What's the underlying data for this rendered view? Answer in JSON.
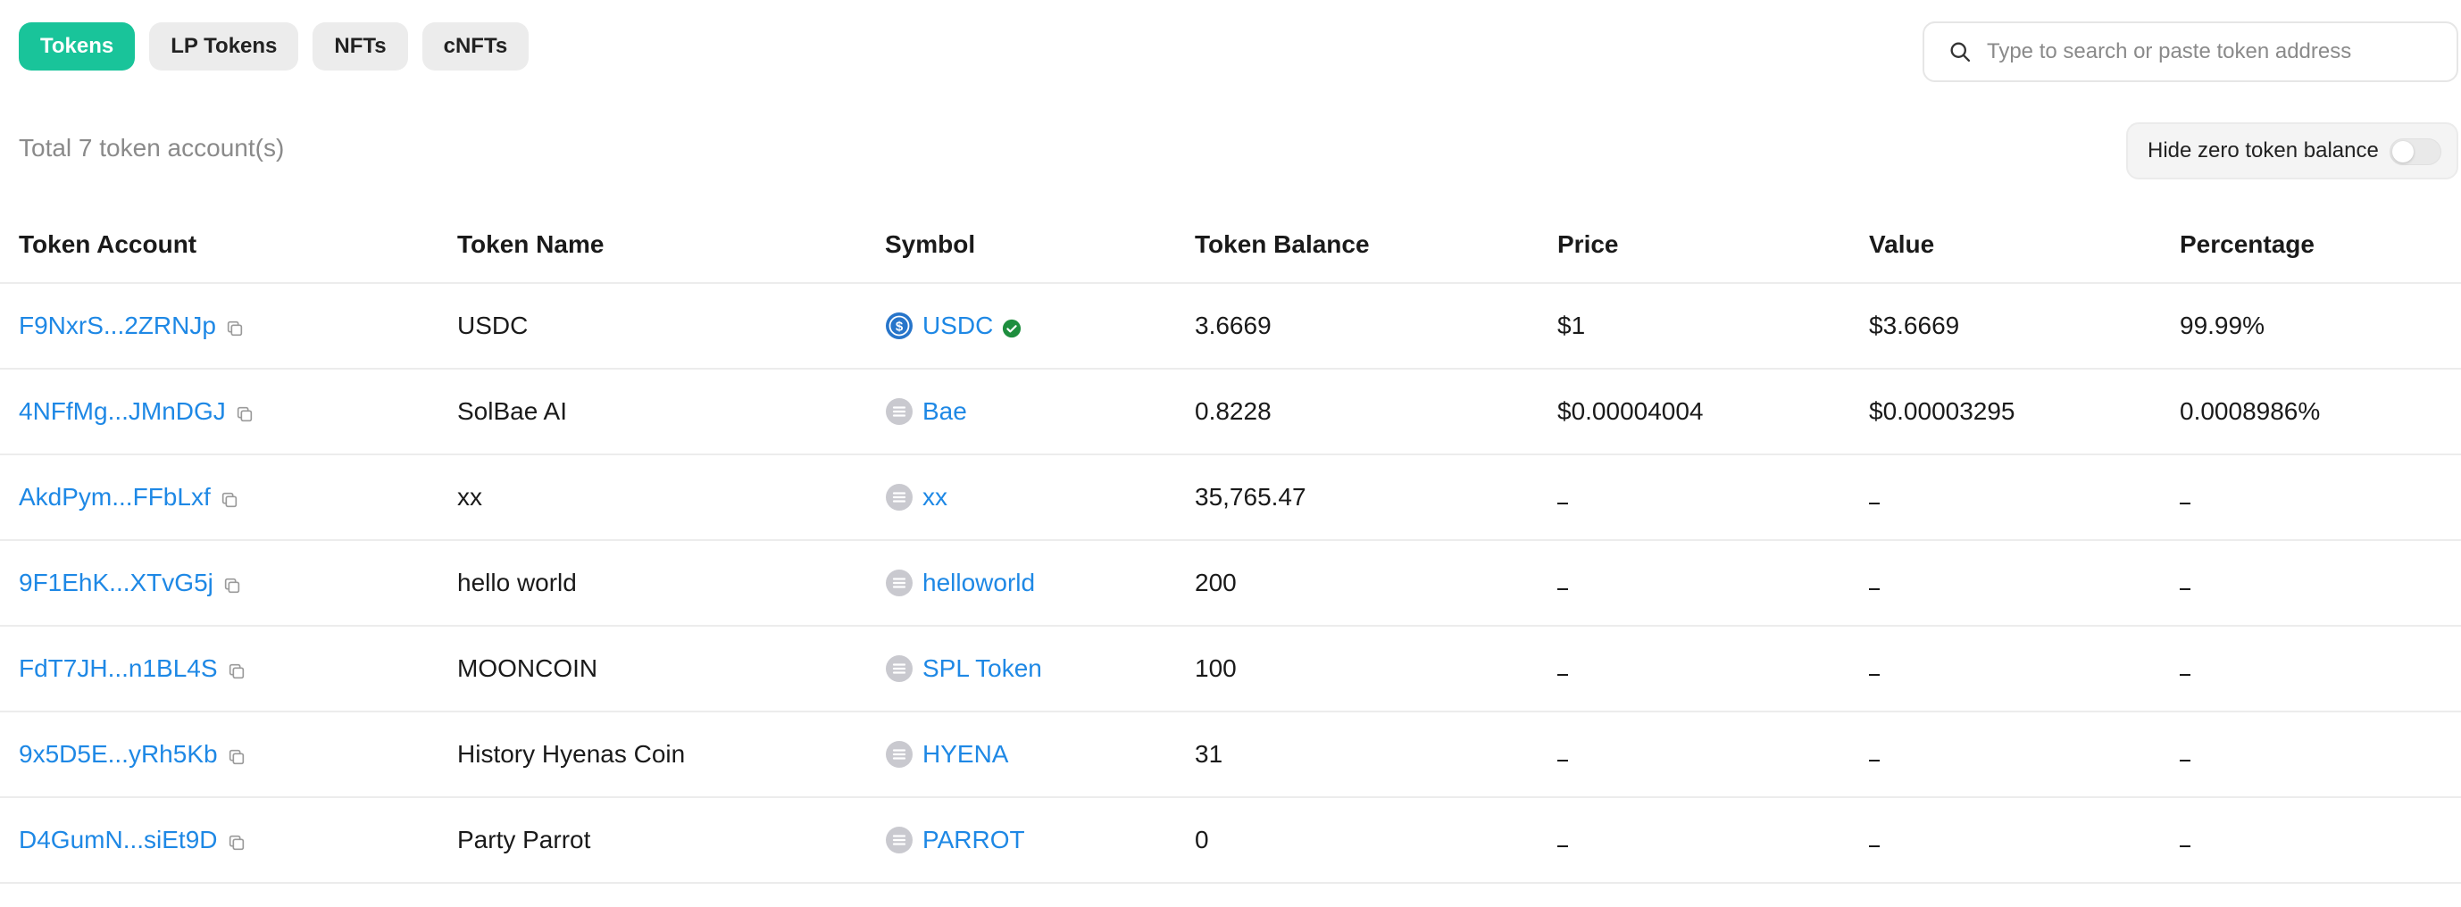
{
  "tabs": [
    {
      "label": "Tokens",
      "active": true
    },
    {
      "label": "LP Tokens",
      "active": false
    },
    {
      "label": "NFTs",
      "active": false
    },
    {
      "label": "cNFTs",
      "active": false
    }
  ],
  "search": {
    "placeholder": "Type to search or paste token address",
    "value": "",
    "icon": "search-icon"
  },
  "summary": {
    "total_text": "Total 7 token account(s)"
  },
  "hide_zero": {
    "label": "Hide zero token balance",
    "enabled": false
  },
  "table": {
    "headers": [
      "Token Account",
      "Token Name",
      "Symbol",
      "Token Balance",
      "Price",
      "Value",
      "Percentage"
    ],
    "rows": [
      {
        "account": "F9NxrS...2ZRNJp",
        "name": "USDC",
        "symbol": "USDC",
        "icon": "usdc-icon",
        "verified": true,
        "balance": "3.6669",
        "price": "$1",
        "value": "$3.6669",
        "percentage": "99.99%"
      },
      {
        "account": "4NFfMg...JMnDGJ",
        "name": "SolBae AI",
        "symbol": "Bae",
        "icon": "generic-token-icon",
        "verified": false,
        "balance": "0.8228",
        "price": "$0.00004004",
        "value": "$0.00003295",
        "percentage": "0.0008986%"
      },
      {
        "account": "AkdPym...FFbLxf",
        "name": "xx",
        "symbol": "xx",
        "icon": "generic-token-icon",
        "verified": false,
        "balance": "35,765.47",
        "price": "",
        "value": "",
        "percentage": ""
      },
      {
        "account": "9F1EhK...XTvG5j",
        "name": "hello world",
        "symbol": "helloworld",
        "icon": "generic-token-icon",
        "verified": false,
        "balance": "200",
        "price": "",
        "value": "",
        "percentage": ""
      },
      {
        "account": "FdT7JH...n1BL4S",
        "name": "MOONCOIN",
        "symbol": "SPL Token",
        "icon": "generic-token-icon",
        "verified": false,
        "balance": "100",
        "price": "",
        "value": "",
        "percentage": ""
      },
      {
        "account": "9x5D5E...yRh5Kb",
        "name": "History Hyenas Coin",
        "symbol": "HYENA",
        "icon": "generic-token-icon",
        "verified": false,
        "balance": "31",
        "price": "",
        "value": "",
        "percentage": ""
      },
      {
        "account": "D4GumN...siEt9D",
        "name": "Party Parrot",
        "symbol": "PARROT",
        "icon": "generic-token-icon",
        "verified": false,
        "balance": "0",
        "price": "",
        "value": "",
        "percentage": ""
      }
    ]
  },
  "colors": {
    "accent": "#19c49a",
    "link": "#1e88e5",
    "verified": "#1e8e3e",
    "usdc": "#2775ca"
  }
}
